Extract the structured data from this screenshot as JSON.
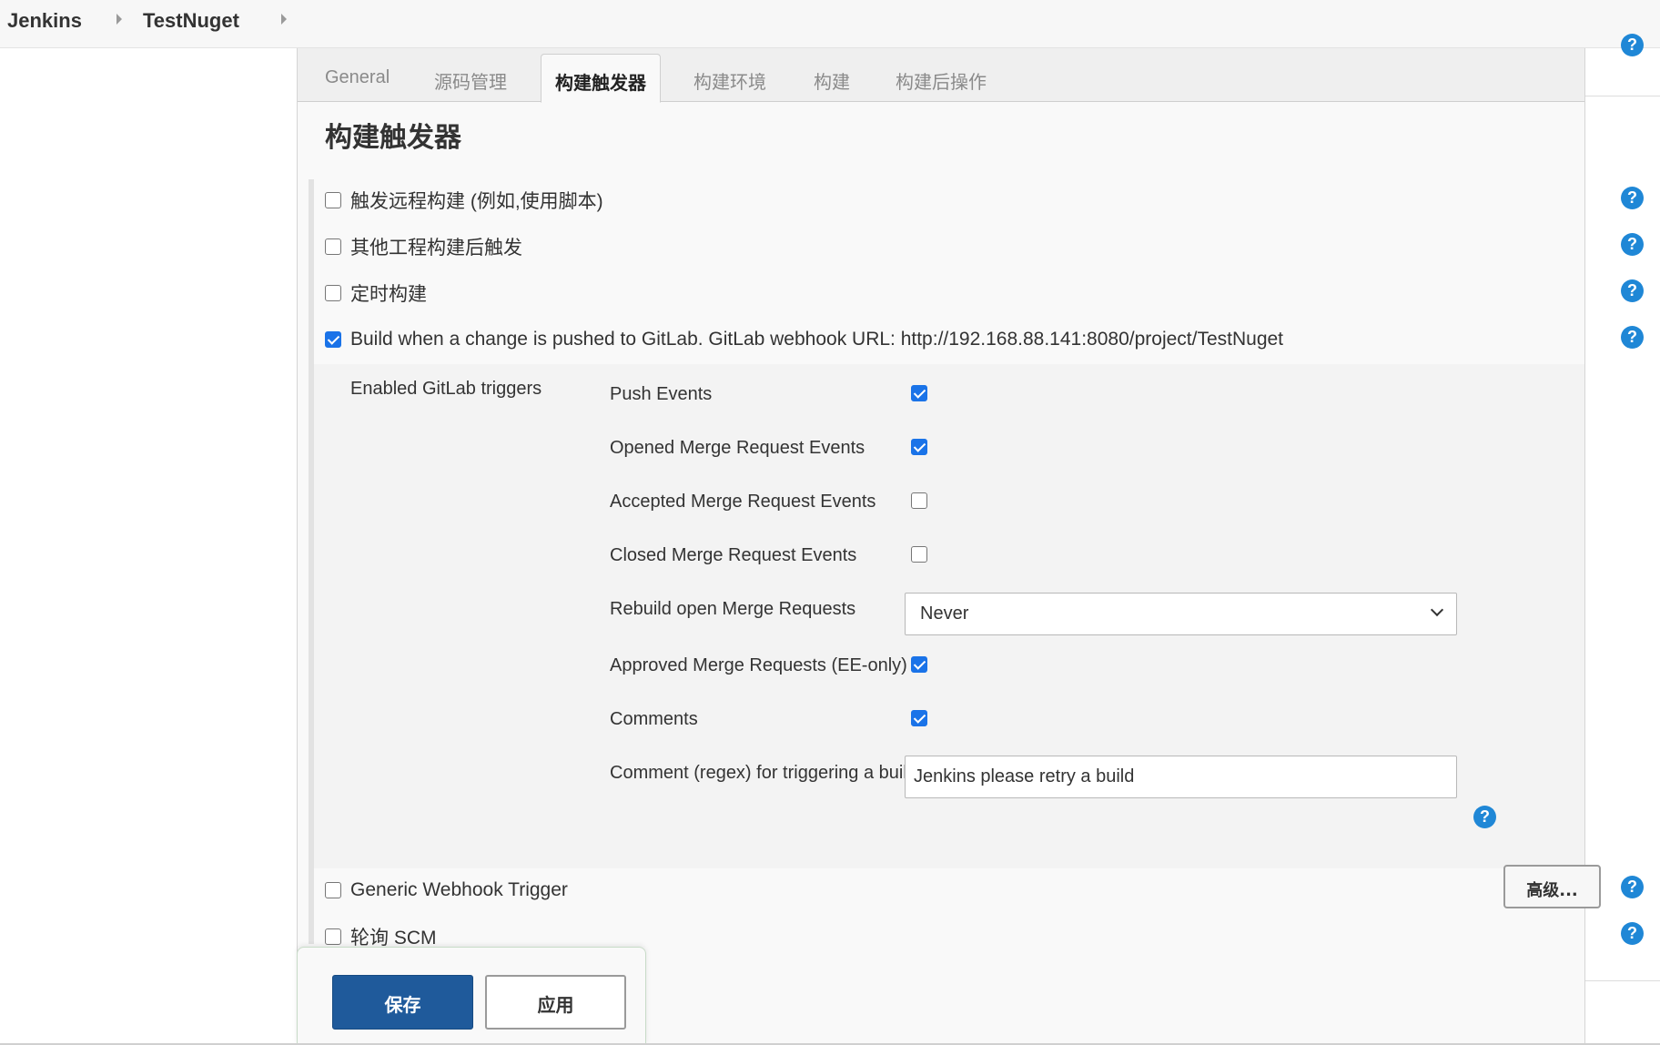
{
  "breadcrumb": {
    "items": [
      "Jenkins",
      "TestNuget"
    ]
  },
  "tabs": [
    "General",
    "源码管理",
    "构建触发器",
    "构建环境",
    "构建",
    "构建后操作"
  ],
  "active_tab": "构建触发器",
  "section_title": "构建触发器",
  "triggers": {
    "remote": {
      "label": "触发远程构建 (例如,使用脚本)",
      "checked": false
    },
    "after_other": {
      "label": "其他工程构建后触发",
      "checked": false
    },
    "timed": {
      "label": "定时构建",
      "checked": false
    },
    "gitlab": {
      "label": "Build when a change is pushed to GitLab. GitLab webhook URL: http://192.168.88.141:8080/project/TestNuget",
      "checked": true
    },
    "generic_webhook": {
      "label": "Generic Webhook Trigger",
      "checked": false
    },
    "poll_scm": {
      "label": "轮询 SCM",
      "checked": false
    }
  },
  "gitlab": {
    "title": "Enabled GitLab triggers",
    "push_events": {
      "label": "Push Events",
      "checked": true
    },
    "opened_mr": {
      "label": "Opened Merge Request Events",
      "checked": true
    },
    "accepted_mr": {
      "label": "Accepted Merge Request Events",
      "checked": false
    },
    "closed_mr": {
      "label": "Closed Merge Request Events",
      "checked": false
    },
    "rebuild_open_mr": {
      "label": "Rebuild open Merge Requests",
      "value": "Never"
    },
    "approved_mr": {
      "label": "Approved Merge Requests (EE-only)",
      "checked": true
    },
    "comments": {
      "label": "Comments",
      "checked": true
    },
    "comment_regex": {
      "label": "Comment (regex) for triggering a build",
      "value": "Jenkins please retry a build"
    },
    "advanced_label": "高级..."
  },
  "actions": {
    "save": "保存",
    "apply": "应用"
  },
  "help_glyph": "?",
  "colors": {
    "accent": "#1f87d6",
    "save_button": "#1f5a9b",
    "checkbox_checked": "#1a73e8"
  }
}
